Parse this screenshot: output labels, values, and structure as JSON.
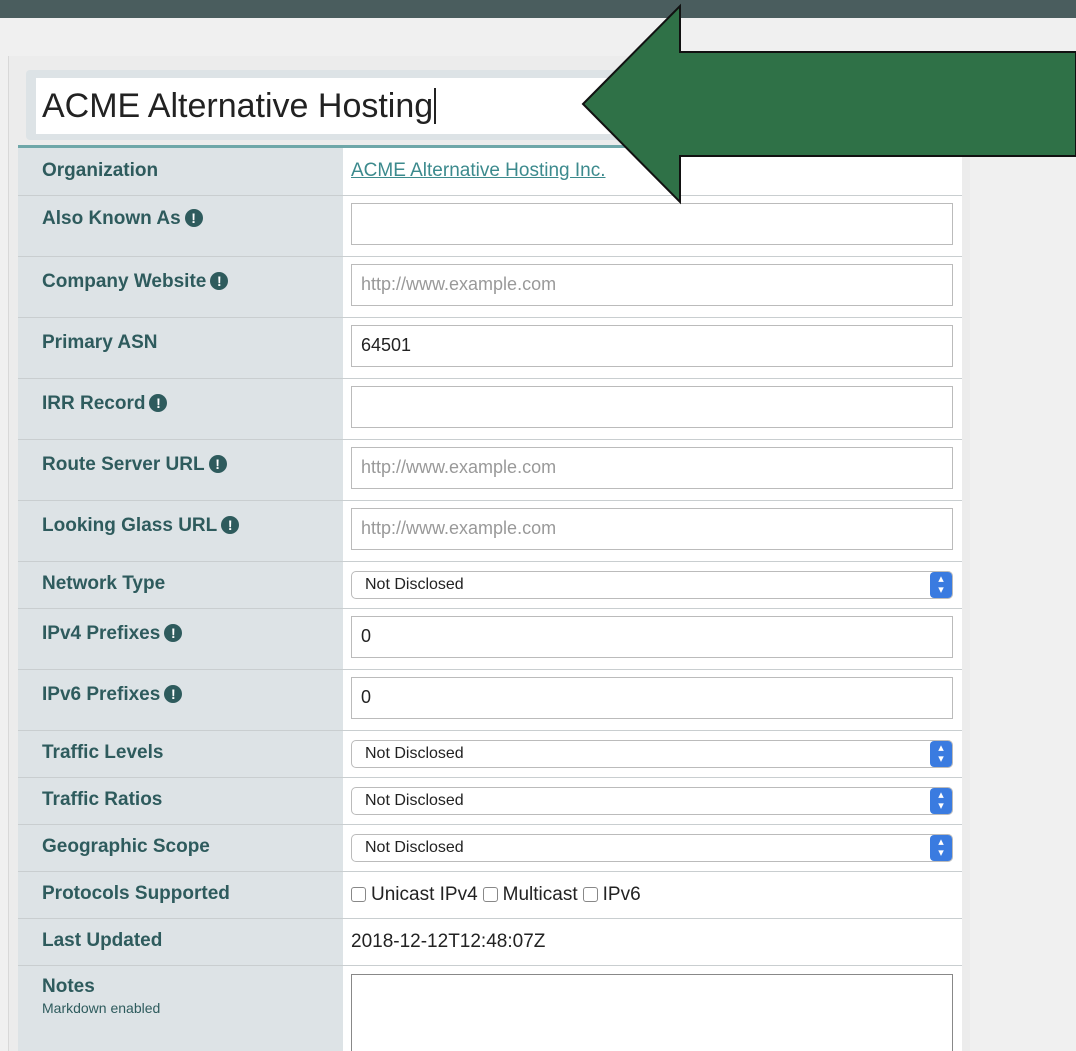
{
  "network_name": "ACME Alternative Hosting",
  "organization": {
    "label": "Organization",
    "value": "ACME Alternative Hosting Inc."
  },
  "also_known_as": {
    "label": "Also Known As",
    "value": ""
  },
  "company_website": {
    "label": "Company Website",
    "placeholder": "http://www.example.com"
  },
  "primary_asn": {
    "label": "Primary ASN",
    "value": "64501"
  },
  "irr_record": {
    "label": "IRR Record",
    "value": ""
  },
  "route_server_url": {
    "label": "Route Server URL",
    "placeholder": "http://www.example.com"
  },
  "looking_glass_url": {
    "label": "Looking Glass URL",
    "placeholder": "http://www.example.com"
  },
  "network_type": {
    "label": "Network Type",
    "value": "Not Disclosed"
  },
  "ipv4_prefixes": {
    "label": "IPv4 Prefixes",
    "value": "0"
  },
  "ipv6_prefixes": {
    "label": "IPv6 Prefixes",
    "value": "0"
  },
  "traffic_levels": {
    "label": "Traffic Levels",
    "value": "Not Disclosed"
  },
  "traffic_ratios": {
    "label": "Traffic Ratios",
    "value": "Not Disclosed"
  },
  "geographic_scope": {
    "label": "Geographic Scope",
    "value": "Not Disclosed"
  },
  "protocols_supported": {
    "label": "Protocols Supported",
    "options": [
      "Unicast IPv4",
      "Multicast",
      "IPv6"
    ]
  },
  "last_updated": {
    "label": "Last Updated",
    "value": "2018-12-12T12:48:07Z"
  },
  "notes": {
    "label": "Notes",
    "sublabel": "Markdown enabled"
  },
  "icons": {
    "info": "info-circle-icon",
    "select_arrows": "updown-chevron-icon",
    "annotation": "green-arrow-left"
  },
  "colors": {
    "label_text": "#2e5b5d",
    "label_bg": "#dde3e6",
    "link": "#3c8a8d",
    "arrow": "#2f7147",
    "topbar": "#4a5d5e"
  }
}
